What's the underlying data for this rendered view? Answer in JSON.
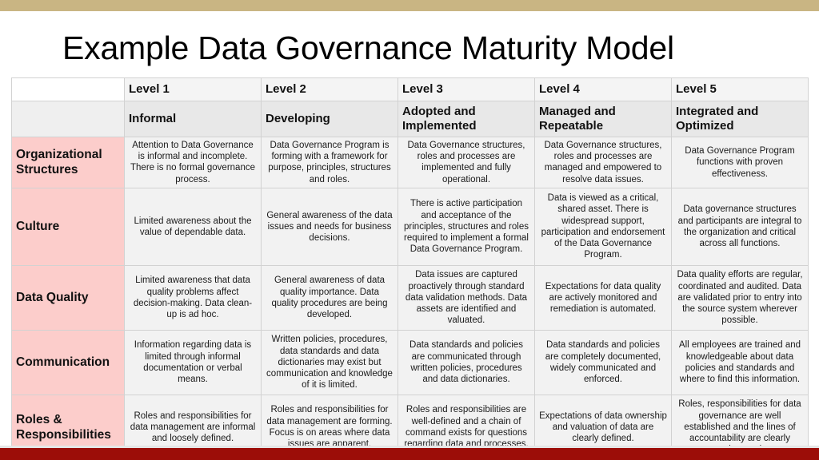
{
  "theme": {
    "top_bar_color": "#c9b583",
    "bottom_bar_color": "#9c0d08",
    "row_header_color": "#fccdcb",
    "cell_color": "#f2f2f2",
    "header_band_1_color": "#f4f4f4",
    "header_band_2_color": "#e8e8e8",
    "grid_line_color": "#d2d2d2"
  },
  "title": "Example Data Governance Maturity Model",
  "table": {
    "corner_label": "",
    "levels": [
      {
        "number": "Level 1",
        "name": "Informal"
      },
      {
        "number": "Level 2",
        "name": "Developing"
      },
      {
        "number": "Level 3",
        "name": "Adopted and Implemented"
      },
      {
        "number": "Level 4",
        "name": "Managed and Repeatable"
      },
      {
        "number": "Level 5",
        "name": "Integrated and Optimized"
      }
    ],
    "rows": [
      {
        "header": "Organizational Structures",
        "cells": [
          "Attention to Data Governance is informal and incomplete.  There is no formal governance process.",
          "Data Governance Program is forming with a framework for purpose, principles, structures and roles.",
          "Data Governance structures, roles and processes are implemented and fully operational.",
          "Data Governance structures, roles and processes are managed and empowered to resolve data issues.",
          "Data Governance Program functions with proven effectiveness."
        ]
      },
      {
        "header": "Culture",
        "cells": [
          "Limited awareness about the value of dependable data.",
          "General awareness of the data issues  and needs for business decisions.",
          "There is active participation and acceptance of the principles, structures and roles required to implement a formal Data Governance Program.",
          "Data is viewed as a critical, shared asset. There is widespread support, participation and endorsement of the Data Governance Program.",
          "Data governance structures and participants are integral to the organization and critical across all functions."
        ]
      },
      {
        "header": "Data Quality",
        "cells": [
          "Limited awareness that data quality problems affect decision-making. Data clean-up is ad hoc.",
          "General awareness of data quality importance.  Data quality procedures are being developed.",
          "Data issues are captured proactively through standard data validation methods. Data assets are identified and valuated.",
          "Expectations for data quality are actively monitored and remediation is automated.",
          "Data quality efforts are regular, coordinated and audited. Data are validated prior to entry into the source system wherever possible."
        ]
      },
      {
        "header": "Communication",
        "cells": [
          "Information regarding data is limited through informal documentation or verbal means.",
          "Written policies, procedures, data standards and data dictionaries may exist but communication and knowledge of it is limited.",
          "Data standards and policies are communicated through written policies, procedures and data dictionaries.",
          "Data standards and policies are completely documented, widely communicated and enforced.",
          "All employees are trained and knowledgeable about data policies and standards and where to find this information."
        ]
      },
      {
        "header": "Roles & Responsibilities",
        "cells": [
          "Roles and responsibilities for data management are informal and loosely defined.",
          "Roles and responsibilities for data management are forming. Focus is on areas where data issues are apparent.",
          "Roles and responsibilities are well-defined and a chain of command exists for questions regarding data and processes.",
          "Expectations of data ownership and valuation of data are clearly defined.",
          "Roles, responsibilities for data governance are well established and the lines of accountability are clearly understood."
        ]
      }
    ]
  }
}
